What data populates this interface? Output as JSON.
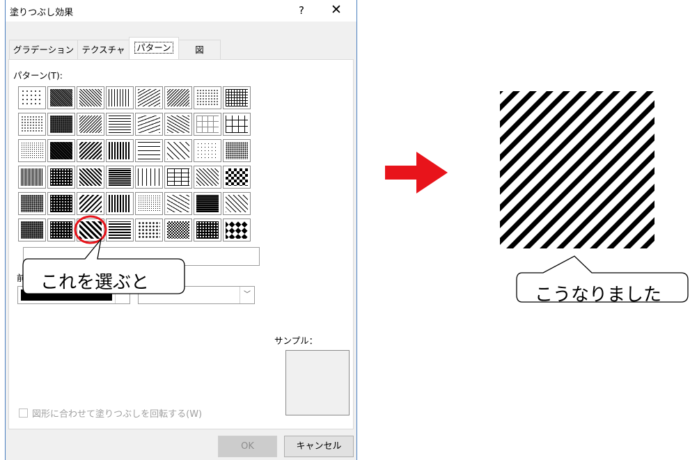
{
  "dialog": {
    "title": "塗りつぶし効果",
    "help": "?",
    "close": "✕",
    "tabs": [
      "グラデーション",
      "テクスチャ",
      "パターン",
      "図"
    ],
    "active_tab": 2,
    "pattern_label": "パターン(T):",
    "foreground_label": "前",
    "sample_label": "サンプル：",
    "rotate_checkbox": "図形に合わせて塗りつぶしを回転する(W)",
    "ok_label": "OK",
    "cancel_label": "キャンセル",
    "foreground_color": "#000000"
  },
  "callouts": {
    "select": "これを選ぶと",
    "result": "こうなりました"
  },
  "colors": {
    "arrow": "#e8141b",
    "highlight_circle": "#e8141b"
  }
}
